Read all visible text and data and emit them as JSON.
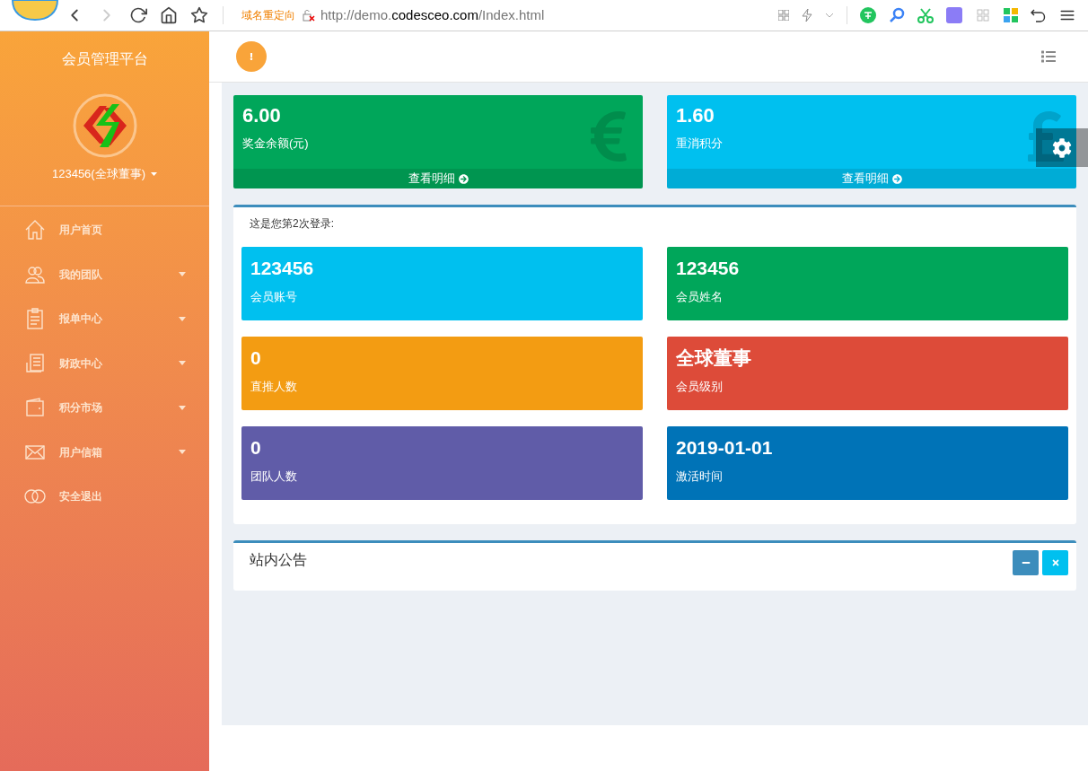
{
  "browser": {
    "redirect_label": "域名重定向",
    "url_prefix": "http://demo.",
    "url_domain": "codesceo.com",
    "url_suffix": "/Index.html"
  },
  "sidebar": {
    "title": "会员管理平台",
    "user": "123456(全球董事)",
    "items": [
      {
        "label": "用户首页",
        "kind": "home",
        "has_submenu": false
      },
      {
        "label": "我的团队",
        "kind": "team",
        "has_submenu": true
      },
      {
        "label": "报单中心",
        "kind": "clipboard",
        "has_submenu": true
      },
      {
        "label": "财政中心",
        "kind": "ledger",
        "has_submenu": true
      },
      {
        "label": "积分市场",
        "kind": "wallet",
        "has_submenu": true
      },
      {
        "label": "用户信箱",
        "kind": "mail",
        "has_submenu": true
      },
      {
        "label": "安全退出",
        "kind": "toggle",
        "has_submenu": false
      }
    ]
  },
  "summary_cards": [
    {
      "value": "6.00",
      "label": "奖金余额(元)",
      "link": "查看明细",
      "color": "#00a65a",
      "kind": "euro"
    },
    {
      "value": "1.60",
      "label": "重消积分",
      "link": "查看明细",
      "color": "#00c0ef",
      "kind": "pound"
    }
  ],
  "login_panel": {
    "message": "这是您第2次登录:",
    "tiles": [
      {
        "value": "123456",
        "label": "会员账号",
        "color": "#00c0ef"
      },
      {
        "value": "123456",
        "label": "会员姓名",
        "color": "#00a65a"
      },
      {
        "value": "0",
        "label": "直推人数",
        "color": "#f39c12"
      },
      {
        "value": "全球董事",
        "label": "会员级别",
        "color": "#dd4b39"
      },
      {
        "value": "0",
        "label": "团队人数",
        "color": "#605ca8"
      },
      {
        "value": "2019-01-01",
        "label": "激活时间",
        "color": "#0073b7"
      }
    ]
  },
  "notice_panel": {
    "title": "站内公告"
  }
}
